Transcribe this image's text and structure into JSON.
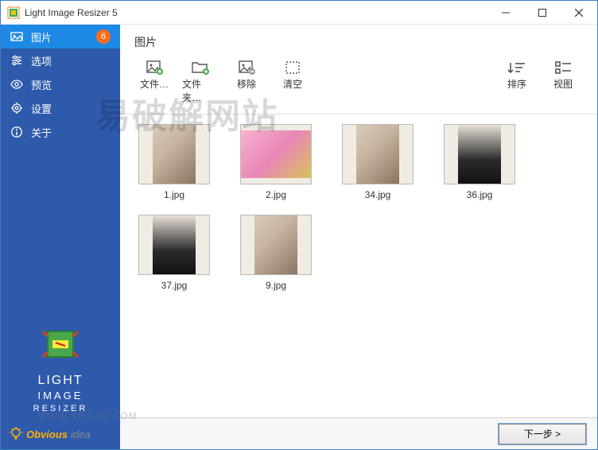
{
  "window": {
    "title": "Light Image Resizer 5"
  },
  "sidebar": {
    "items": [
      {
        "label": "图片",
        "badge": "6"
      },
      {
        "label": "选项"
      },
      {
        "label": "预览"
      },
      {
        "label": "设置"
      },
      {
        "label": "关于"
      }
    ],
    "brand": {
      "line1": "LIGHT",
      "line2": "IMAGE",
      "line3": "RESIZER"
    },
    "obvious": {
      "name": "Obvious",
      "idea": "idea"
    }
  },
  "main": {
    "header": "图片",
    "toolbar": {
      "add_file": "文件…",
      "add_folder": "文件夹…",
      "remove": "移除",
      "clear": "清空",
      "sort": "排序",
      "view": "视图"
    },
    "thumbs": [
      {
        "label": "1.jpg",
        "orient": "portrait",
        "tone": "plain"
      },
      {
        "label": "2.jpg",
        "orient": "landscape",
        "tone": "pink"
      },
      {
        "label": "34.jpg",
        "orient": "portrait",
        "tone": "plain"
      },
      {
        "label": "36.jpg",
        "orient": "portrait",
        "tone": "dark"
      },
      {
        "label": "37.jpg",
        "orient": "portrait",
        "tone": "dark"
      },
      {
        "label": "9.jpg",
        "orient": "portrait",
        "tone": "plain"
      }
    ]
  },
  "footer": {
    "next": "下一步 >"
  },
  "watermark": {
    "text": "易破解网站",
    "url": "WWW.YPOJIE.COM"
  }
}
